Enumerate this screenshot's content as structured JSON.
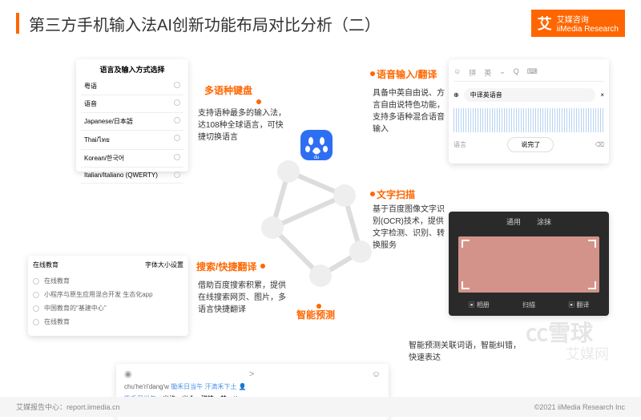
{
  "header": {
    "title": "第三方手机输入法AI创新功能布局对比分析（二）",
    "logo_text": "艾媒咨询",
    "logo_sub": "iiMedia Research"
  },
  "features": {
    "f1": {
      "title": "多语种键盘",
      "desc": "支持语种最多的输入法，达108种全球语言，可快捷切换语言"
    },
    "f2": {
      "title": "搜索/快捷翻译",
      "desc": "借助百度搜索积累，提供在线搜索网页、图片，多语言快捷翻译"
    },
    "f3": {
      "title": "语音输入/翻译",
      "desc": "具备中英自由说、方言自由说特色功能，支持多语种混合语音输入"
    },
    "f4": {
      "title": "文字扫描",
      "desc": "基于百度图像文字识别(OCR)技术，提供文字检测、识别、转换服务"
    },
    "f5": {
      "title": "智能预测",
      "desc": "智能预测关联词语，智能纠错，快速表达"
    }
  },
  "card1": {
    "header": "语言及输入方式选择",
    "rows": [
      "粤语",
      "语音",
      "Japanese/日本語",
      "Thai/ไทย",
      "Korean/한국어",
      "Italian/Italiano (QWERTY)"
    ]
  },
  "card2": {
    "left": "在线教育",
    "right": "字体大小设置",
    "opts": [
      "在线教育",
      "小程序与原生应用混合开发 生态化app",
      "中国教育的\"基建中心\"",
      "在线教育"
    ]
  },
  "card3": {
    "tabs": [
      "拼",
      "英"
    ],
    "field": "中译英语音",
    "done": "说完了"
  },
  "card4": {
    "tabs": [
      "通用",
      "涂抹"
    ],
    "btm": [
      "相册",
      "扫描",
      "翻译"
    ]
  },
  "card5": {
    "pinyin": "chu'he'ri'dang'w",
    "suggest": "锄禾日当午 汗滴禾下土",
    "cands": [
      "锄禾日当午",
      "出格",
      "出个",
      "磁铁",
      "楚"
    ]
  },
  "footer": {
    "left": "艾媒报告中心：report.iimedia.cn",
    "right": "©2021 iiMedia Research Inc"
  },
  "watermark": "雪球",
  "wm2": "艾媒网"
}
